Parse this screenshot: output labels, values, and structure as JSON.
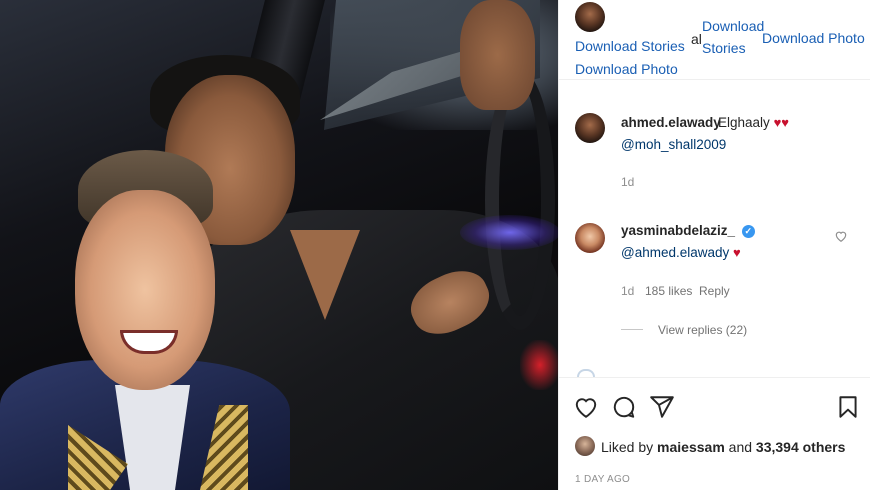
{
  "header": {
    "download_stories_1": "Download Stories",
    "download_photo_1": "Download Photo",
    "al_text": "al",
    "download_stories_2_line1": "Download",
    "download_stories_2_line2": "Stories",
    "download_photo_2": "Download Photo"
  },
  "comments": [
    {
      "username": "ahmed.elawady",
      "text": "Elghaaly",
      "hearts": "♥♥",
      "mention": "@moh_shall2009",
      "age": "1d"
    },
    {
      "username": "yasminabdelaziz_",
      "verified_mark": "✓",
      "mention": "@ahmed.elawady",
      "hearts": "♥",
      "age": "1d",
      "likes": "185 likes",
      "reply": "Reply",
      "view_replies": "View replies (22)"
    }
  ],
  "likes": {
    "prefix": "Liked by",
    "user": "maiessam",
    "middle": "and",
    "others": "33,394 others"
  },
  "post_time": "1 DAY AGO",
  "colors": {
    "link_blue": "#1a5fb4",
    "mention_blue": "#00376b",
    "heart_red": "#c8102e",
    "verified_blue": "#3897f0",
    "muted": "#8e8e8e"
  },
  "icons": [
    "heart-icon",
    "comment-icon",
    "share-icon",
    "bookmark-icon",
    "small-heart-icon",
    "verified-badge-icon"
  ]
}
